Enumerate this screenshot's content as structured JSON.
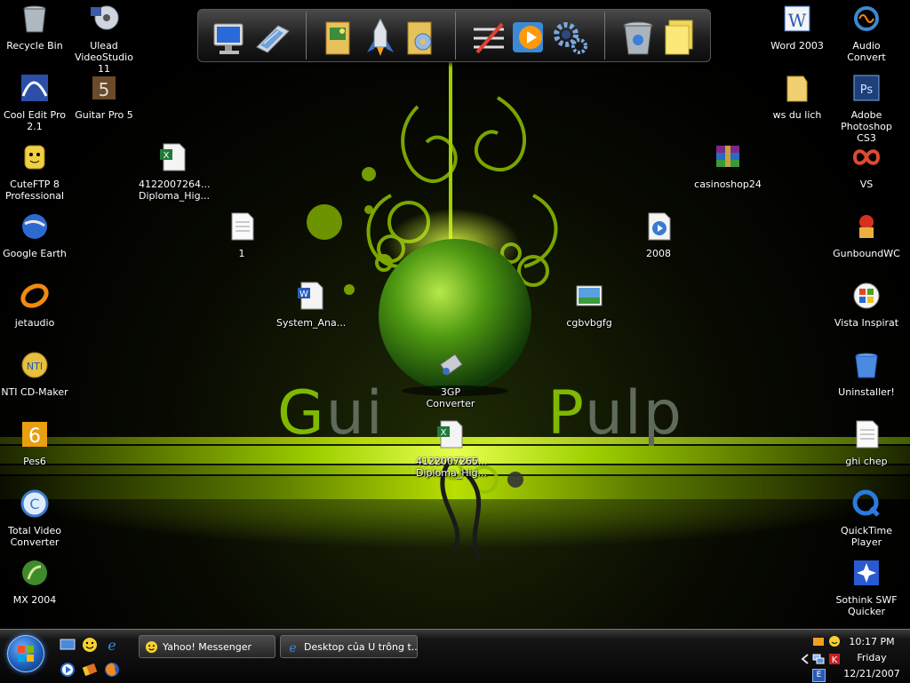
{
  "wallpaper": {
    "text_left": {
      "first": "G",
      "rest": "ui"
    },
    "text_right": {
      "first": "P",
      "rest": "ulp"
    },
    "accent": "#9ed000"
  },
  "dock": {
    "items": [
      {
        "name": "computer-icon"
      },
      {
        "name": "network-disk-icon"
      },
      {
        "name": "folder-pictures-icon"
      },
      {
        "name": "rocket-icon"
      },
      {
        "name": "folder-music-icon"
      },
      {
        "name": "tools-icon"
      },
      {
        "name": "media-player-icon"
      },
      {
        "name": "settings-gear-icon"
      },
      {
        "name": "recycle-bin-icon"
      },
      {
        "name": "sticky-notes-icon"
      }
    ]
  },
  "desktop": {
    "icons": [
      {
        "label": "Recycle Bin",
        "icon": "recycle-bin-icon"
      },
      {
        "label": "Ulead VideoStudio 11",
        "icon": "ulead-videostudio-icon"
      },
      {
        "label": "Cool Edit Pro 2.1",
        "icon": "cool-edit-icon"
      },
      {
        "label": "Guitar Pro 5",
        "icon": "guitar-pro-icon"
      },
      {
        "label": "CuteFTP 8 Professional",
        "icon": "cuteftp-icon"
      },
      {
        "label": "4122007264... Diploma_Hig...",
        "icon": "excel-file-icon"
      },
      {
        "label": "Google Earth",
        "icon": "google-earth-icon"
      },
      {
        "label": "1",
        "icon": "text-file-icon"
      },
      {
        "label": "jetaudio",
        "icon": "jetaudio-icon"
      },
      {
        "label": "System_Ana...",
        "icon": "word-file-icon"
      },
      {
        "label": "NTI CD-Maker",
        "icon": "nti-cd-maker-icon"
      },
      {
        "label": "3GP Converter",
        "icon": "3gp-converter-icon"
      },
      {
        "label": "Pes6",
        "icon": "pes6-icon"
      },
      {
        "label": "4122007265... Diploma_Hig...",
        "icon": "excel-file-icon"
      },
      {
        "label": "Total Video Converter",
        "icon": "total-video-converter-icon"
      },
      {
        "label": "MX 2004",
        "icon": "macromedia-mx-icon"
      },
      {
        "label": "cgbvbgfg",
        "icon": "image-file-icon"
      },
      {
        "label": "casinoshop24",
        "icon": "winrar-archive-icon"
      },
      {
        "label": "2008",
        "icon": "video-file-icon"
      },
      {
        "label": "Word 2003",
        "icon": "word-2003-icon"
      },
      {
        "label": "Audio Convert",
        "icon": "audio-convert-icon"
      },
      {
        "label": "ws du lich",
        "icon": "folder-icon"
      },
      {
        "label": "Adobe Photoshop CS3",
        "icon": "photoshop-icon"
      },
      {
        "label": "VS",
        "icon": "visual-studio-icon"
      },
      {
        "label": "GunboundWC",
        "icon": "gunbound-icon"
      },
      {
        "label": "Vista Inspirat",
        "icon": "vista-inspirat-icon"
      },
      {
        "label": "Uninstaller!",
        "icon": "uninstaller-icon"
      },
      {
        "label": "ghi chep",
        "icon": "text-file-icon"
      },
      {
        "label": "QuickTime Player",
        "icon": "quicktime-icon"
      },
      {
        "label": "Sothink SWF Quicker",
        "icon": "sothink-swf-icon"
      }
    ]
  },
  "taskbar": {
    "quick_launch": [
      {
        "name": "show-desktop-icon"
      },
      {
        "name": "yahoo-messenger-ql-icon"
      },
      {
        "name": "internet-explorer-ql-icon"
      },
      {
        "name": "media-player-ql-icon"
      },
      {
        "name": "switch-windows-icon"
      },
      {
        "name": "firefox-ql-icon"
      }
    ],
    "tasks": [
      {
        "label": "Yahoo! Messenger",
        "icon": "yahoo-messenger-icon"
      },
      {
        "label": "Desktop của U trông t...",
        "icon": "internet-explorer-icon"
      }
    ],
    "tray": {
      "time": "10:17 PM",
      "day": "Friday",
      "date": "12/21/2007",
      "language": "E"
    }
  }
}
